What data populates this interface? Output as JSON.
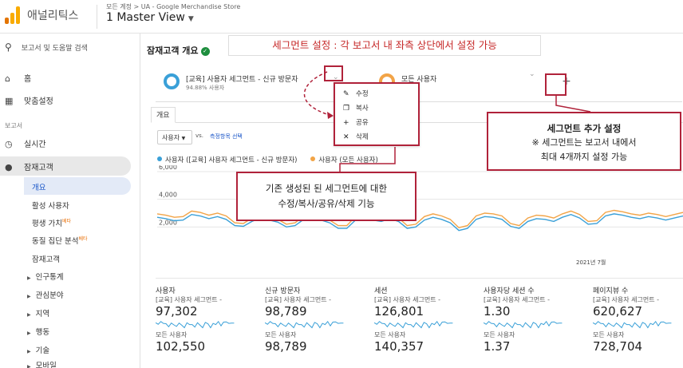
{
  "app": {
    "name": "애널리틱스",
    "breadcrumb": "모든 계정 > UA - Google Merchandise Store",
    "view": "1 Master View",
    "colors": {
      "logo_dark": "#e37400",
      "logo_light": "#f9ab00"
    }
  },
  "sidebar": {
    "search_placeholder": "보고서 및 도움말 검색",
    "home": "홈",
    "custom": "맞춤설정",
    "section_reports": "보고서",
    "realtime": "실시간",
    "audience": "잠재고객",
    "audience_items": [
      {
        "label": "개요",
        "badge": ""
      },
      {
        "label": "활성 사용자",
        "badge": ""
      },
      {
        "label": "평생 가치",
        "badge": "베타"
      },
      {
        "label": "동질 집단 분석",
        "badge": "베타"
      },
      {
        "label": "잠재고객",
        "badge": ""
      }
    ],
    "tree_items": [
      "인구통계",
      "관심분야",
      "지역",
      "행동",
      "기술",
      "모바일"
    ]
  },
  "main": {
    "title": "잠재고객 개요",
    "segments": [
      {
        "name": "[교육] 사용자 세그먼트 - 신규 방문자",
        "sub": "94.88% 사용자",
        "color": "#3aa0d8"
      },
      {
        "name": "모든 사용자",
        "sub": "",
        "color": "#f2a447"
      }
    ],
    "add_segment_icon": "plus-icon",
    "tab": "개요",
    "metric_select": "사용자",
    "vs_label": "vs.",
    "vs_link": "측정항목 선택",
    "legend": [
      {
        "label": "사용자 ([교육] 사용자 세그먼트 - 신규 방문자)",
        "color": "#3aa0d8"
      },
      {
        "label": "사용자 (모든 사용자)",
        "color": "#f2a447"
      }
    ],
    "date_label": "2021년 7월"
  },
  "chart_data": {
    "type": "line",
    "ylim": [
      0,
      6000
    ],
    "yticks": [
      "6,000",
      "4,000",
      "2,000"
    ],
    "x_label": "2021년 7월",
    "series": [
      {
        "name": "사용자 ([교육] 사용자 세그먼트 - 신규 방문자)",
        "color": "#3aa0d8",
        "values": [
          2700,
          2600,
          2450,
          2500,
          2900,
          2800,
          2600,
          2750,
          2550,
          2100,
          2050,
          2400,
          2650,
          2500,
          2350,
          2000,
          2100,
          2550,
          2650,
          2500,
          2300,
          1900,
          1900,
          2500,
          2700,
          2500,
          2400,
          2600,
          2400,
          1900,
          2000,
          2500,
          2700,
          2550,
          2300,
          1750,
          1900,
          2550,
          2750,
          2700,
          2550,
          2050,
          1900,
          2400,
          2600,
          2550,
          2400,
          2700,
          2900,
          2650,
          2200,
          2250,
          2800,
          2950,
          2850,
          2700,
          2600,
          2750,
          2650,
          2500,
          2650,
          2800
        ]
      },
      {
        "name": "사용자 (모든 사용자)",
        "color": "#f2a447",
        "values": [
          2950,
          2850,
          2700,
          2750,
          3150,
          3050,
          2850,
          3000,
          2800,
          2300,
          2250,
          2650,
          2900,
          2750,
          2550,
          2200,
          2300,
          2800,
          2900,
          2750,
          2500,
          2100,
          2100,
          2750,
          2950,
          2750,
          2650,
          2850,
          2650,
          2100,
          2200,
          2750,
          2950,
          2800,
          2550,
          1950,
          2100,
          2800,
          3000,
          2950,
          2800,
          2250,
          2100,
          2650,
          2850,
          2800,
          2650,
          2950,
          3150,
          2900,
          2400,
          2450,
          3050,
          3200,
          3100,
          2950,
          2850,
          3000,
          2900,
          2750,
          2900,
          3050
        ]
      }
    ]
  },
  "metrics": [
    {
      "label": "사용자",
      "seg1": "[교육] 사용자 세그먼트 -",
      "v1": "97,302",
      "seg2": "모든 사용자",
      "v2": "102,550"
    },
    {
      "label": "신규 방문자",
      "seg1": "[교육] 사용자 세그먼트 -",
      "v1": "98,789",
      "seg2": "모든 사용자",
      "v2": "98,789"
    },
    {
      "label": "세션",
      "seg1": "[교육] 사용자 세그먼트 -",
      "v1": "126,801",
      "seg2": "모든 사용자",
      "v2": "140,357"
    },
    {
      "label": "사용자당 세션 수",
      "seg1": "[교육] 사용자 세그먼트 -",
      "v1": "1.30",
      "seg2": "모든 사용자",
      "v2": "1.37"
    },
    {
      "label": "페이지뷰 수",
      "seg1": "[교육] 사용자 세그먼트 -",
      "v1": "620,627",
      "seg2": "모든 사용자",
      "v2": "728,704"
    }
  ],
  "segment_menu": [
    {
      "label": "수정",
      "icon": "pencil-icon"
    },
    {
      "label": "복사",
      "icon": "copy-icon"
    },
    {
      "label": "공유",
      "icon": "share-icon"
    },
    {
      "label": "삭제",
      "icon": "close-icon"
    }
  ],
  "annotations": {
    "banner": "세그먼트 설정 : 각 보고서 내 좌측 상단에서 설정 가능",
    "middle_line1": "기존 생성된 된 세그먼트에 대한",
    "middle_line2": "수정/복사/공유/삭제 기능",
    "right_title": "세그먼트 추가 설정",
    "right_line1": "※ 세그먼트는 보고서 내에서",
    "right_line2": "최대 4개까지 설정 가능",
    "accent_color": "#b0223a"
  }
}
